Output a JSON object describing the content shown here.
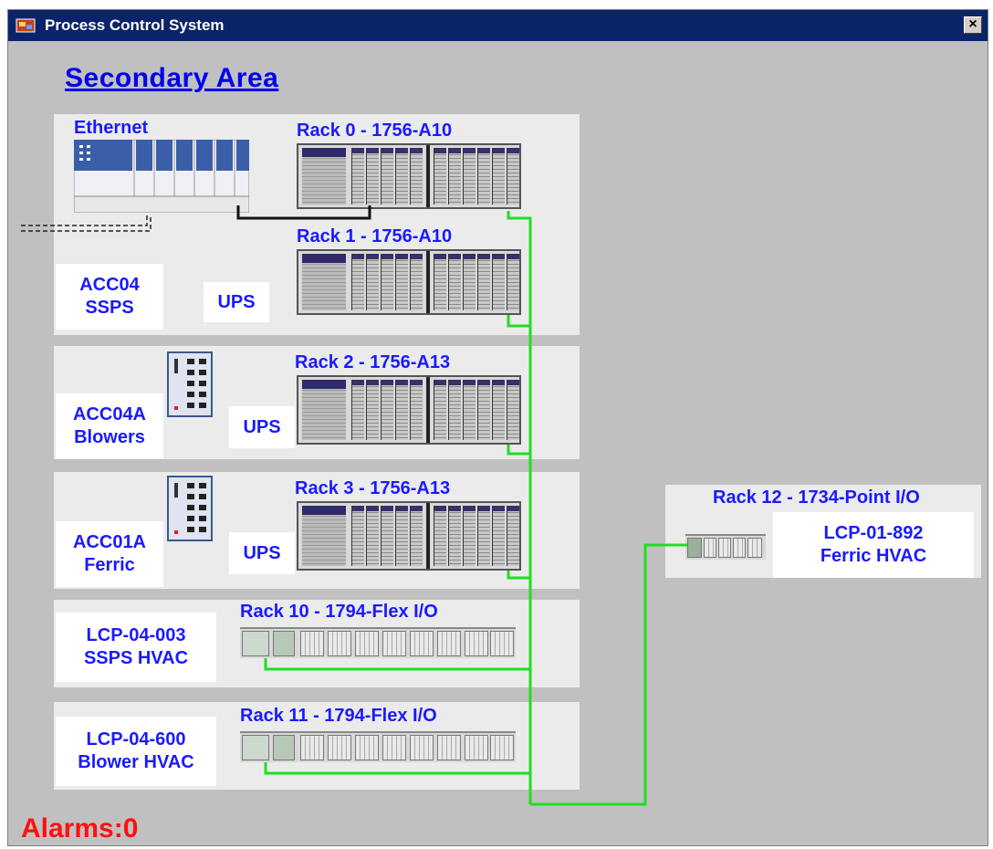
{
  "window": {
    "title": "Process Control System",
    "close_label": "×"
  },
  "heading": "Secondary Area",
  "ethernet": {
    "label": "Ethernet"
  },
  "racks": {
    "r0": "Rack 0 - 1756-A10",
    "r1": "Rack 1 - 1756-A10",
    "r2": "Rack 2 - 1756-A13",
    "r3": "Rack 3 - 1756-A13",
    "r10": "Rack 10 - 1794-Flex I/O",
    "r11": "Rack 11 - 1794-Flex I/O",
    "r12": "Rack 12 - 1734-Point I/O"
  },
  "boxes": {
    "acc04": [
      "ACC04",
      "SSPS"
    ],
    "ups1": "UPS",
    "acc04a": [
      "ACC04A",
      "Blowers"
    ],
    "ups2": "UPS",
    "acc01a": [
      "ACC01A",
      "Ferric"
    ],
    "ups3": "UPS",
    "lcp04003": [
      "LCP-04-003",
      "SSPS HVAC"
    ],
    "lcp04600": [
      "LCP-04-600",
      "Blower HVAC"
    ],
    "lcp01892": [
      "LCP-01-892",
      "Ferric HVAC"
    ]
  },
  "alarms": "Alarms:0",
  "colors": {
    "titlebar": "#0a246a",
    "label_blue": "#1a1aff",
    "network_green": "#22dd22",
    "alarm_red": "#ff1010"
  }
}
